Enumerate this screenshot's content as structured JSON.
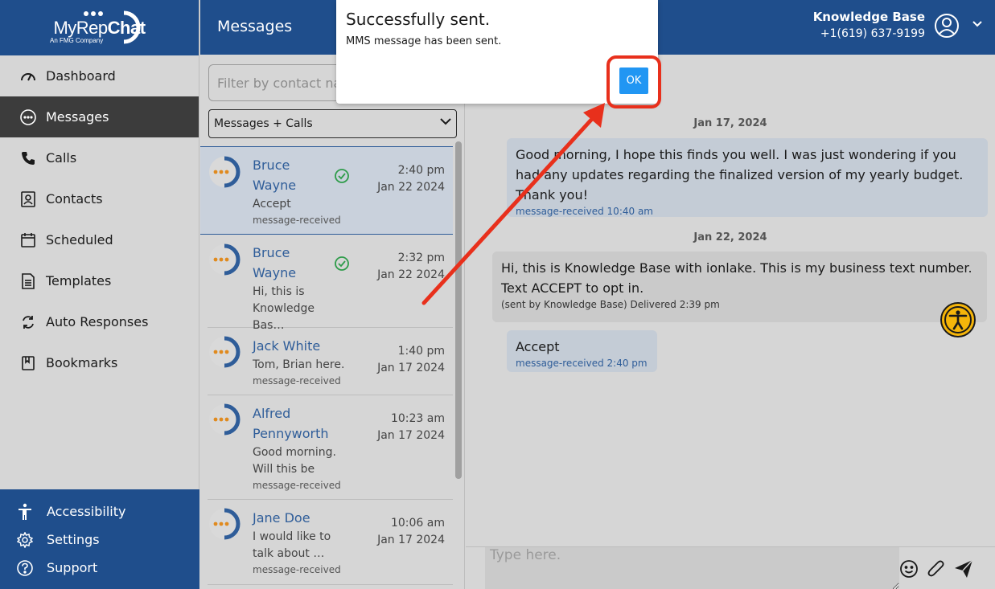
{
  "brand": {
    "name_prefix": "MyRep",
    "name_suffix": "Chat",
    "tagline": "An FMG Company"
  },
  "sidebar": {
    "items": [
      {
        "label": "Dashboard",
        "icon": "dashboard-gauge-icon"
      },
      {
        "label": "Messages",
        "icon": "chat-bubble-icon",
        "active": true
      },
      {
        "label": "Calls",
        "icon": "phone-icon"
      },
      {
        "label": "Contacts",
        "icon": "contact-card-icon"
      },
      {
        "label": "Scheduled",
        "icon": "calendar-icon"
      },
      {
        "label": "Templates",
        "icon": "document-icon"
      },
      {
        "label": "Auto Responses",
        "icon": "refresh-icon"
      },
      {
        "label": "Bookmarks",
        "icon": "bookmark-icon"
      }
    ],
    "bottom": [
      {
        "label": "Accessibility",
        "icon": "accessibility-person-icon"
      },
      {
        "label": "Settings",
        "icon": "gear-icon"
      },
      {
        "label": "Support",
        "icon": "question-circle-icon"
      }
    ]
  },
  "header": {
    "title": "Messages",
    "account_name": "Knowledge Base",
    "account_phone": "+1(619) 637-9199"
  },
  "list": {
    "filter_placeholder": "Filter by contact name",
    "type_selected": "Messages + Calls",
    "conversations": [
      {
        "name": "Bruce Wayne",
        "preview": "Accept",
        "status": "message-received",
        "time": "2:40 pm",
        "date": "Jan 22 2024",
        "checked": true,
        "selected": true
      },
      {
        "name": "Bruce Wayne",
        "preview": "Hi, this is Knowledge Bas…",
        "status": "",
        "time": "2:32 pm",
        "date": "Jan 22 2024",
        "checked": true
      },
      {
        "name": "Jack White",
        "preview": "Tom, Brian here.",
        "status": "message-received",
        "time": "1:40 pm",
        "date": "Jan 17 2024"
      },
      {
        "name": "Alfred Pennyworth",
        "preview": "Good morning. Will this be rolle…",
        "status": "message-received",
        "time": "10:23 am",
        "date": "Jan 17 2024"
      },
      {
        "name": "Jane Doe",
        "preview": "I would like to talk about …",
        "status": "message-received",
        "time": "10:06 am",
        "date": "Jan 17 2024"
      }
    ]
  },
  "chat": {
    "date_1": "Jan 17, 2024",
    "msg_1_text": "Good morning, I hope this finds you well. I was just wondering if you had any updates regarding the finalized version of my yearly budget. Thank you!",
    "msg_1_meta": "message-received 10:40 am",
    "date_2": "Jan 22, 2024",
    "msg_2_text": "Hi, this is Knowledge Base with ionlake. This is my business text number. Text ACCEPT to opt in.",
    "msg_2_meta": "(sent by Knowledge Base) Delivered 2:39 pm",
    "msg_3_text": "Accept",
    "msg_3_meta": "message-received 2:40 pm",
    "compose_placeholder": "Type here."
  },
  "dialog": {
    "title": "Successfully sent.",
    "message": "MMS message has been sent.",
    "ok_label": "OK"
  },
  "colors": {
    "brand_blue": "#1f4e8c",
    "link_blue": "#2f5d99",
    "ok_blue": "#2196f3",
    "annotation_red": "#e8301c",
    "accent_orange": "#e08a1e"
  }
}
